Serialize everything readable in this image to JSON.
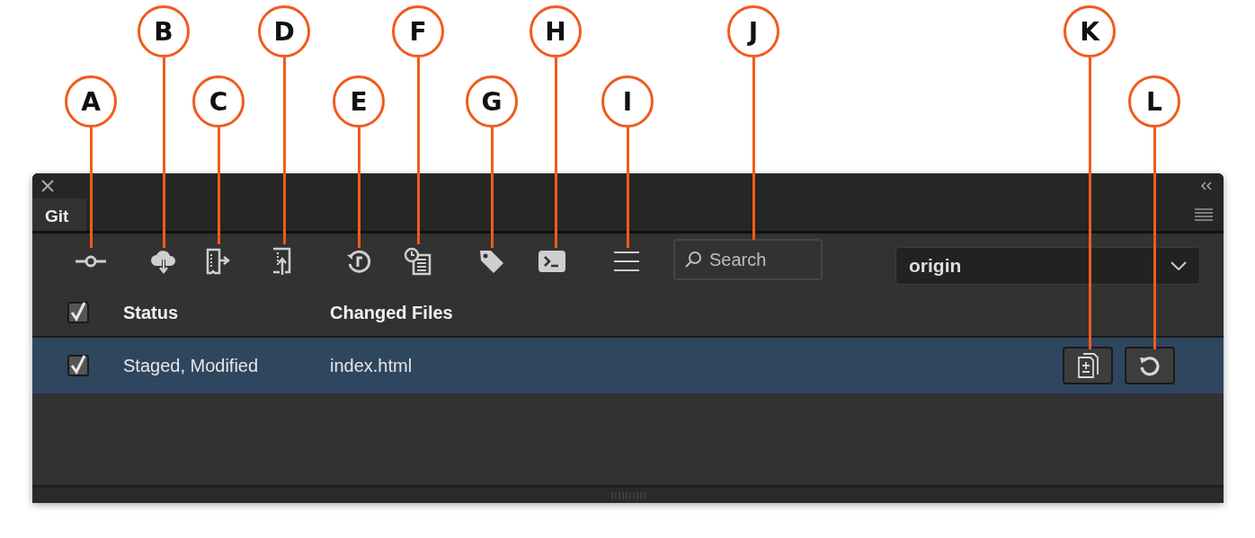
{
  "callouts": [
    {
      "label": "A"
    },
    {
      "label": "B"
    },
    {
      "label": "C"
    },
    {
      "label": "D"
    },
    {
      "label": "E"
    },
    {
      "label": "F"
    },
    {
      "label": "G"
    },
    {
      "label": "H"
    },
    {
      "label": "I"
    },
    {
      "label": "J"
    },
    {
      "label": "K"
    },
    {
      "label": "L"
    }
  ],
  "panel": {
    "tabs": [
      {
        "label": "Git",
        "selected": true
      }
    ]
  },
  "toolbar": {
    "buttons": [
      {
        "kind": "commit"
      },
      {
        "kind": "fetch"
      },
      {
        "kind": "pull"
      },
      {
        "kind": "push"
      },
      {
        "kind": "revert"
      },
      {
        "kind": "history"
      },
      {
        "kind": "tag"
      },
      {
        "kind": "terminal"
      },
      {
        "kind": "menu"
      }
    ],
    "search": {
      "placeholder": "Search"
    },
    "remote": {
      "value": "origin"
    }
  },
  "table": {
    "header": {
      "checked": true,
      "columns": [
        "Status",
        "Changed Files"
      ]
    },
    "rows": [
      {
        "checked": true,
        "selected": true,
        "status": "Staged, Modified",
        "file": "index.html",
        "actions": [
          {
            "kind": "diff"
          },
          {
            "kind": "revert"
          }
        ]
      }
    ]
  }
}
